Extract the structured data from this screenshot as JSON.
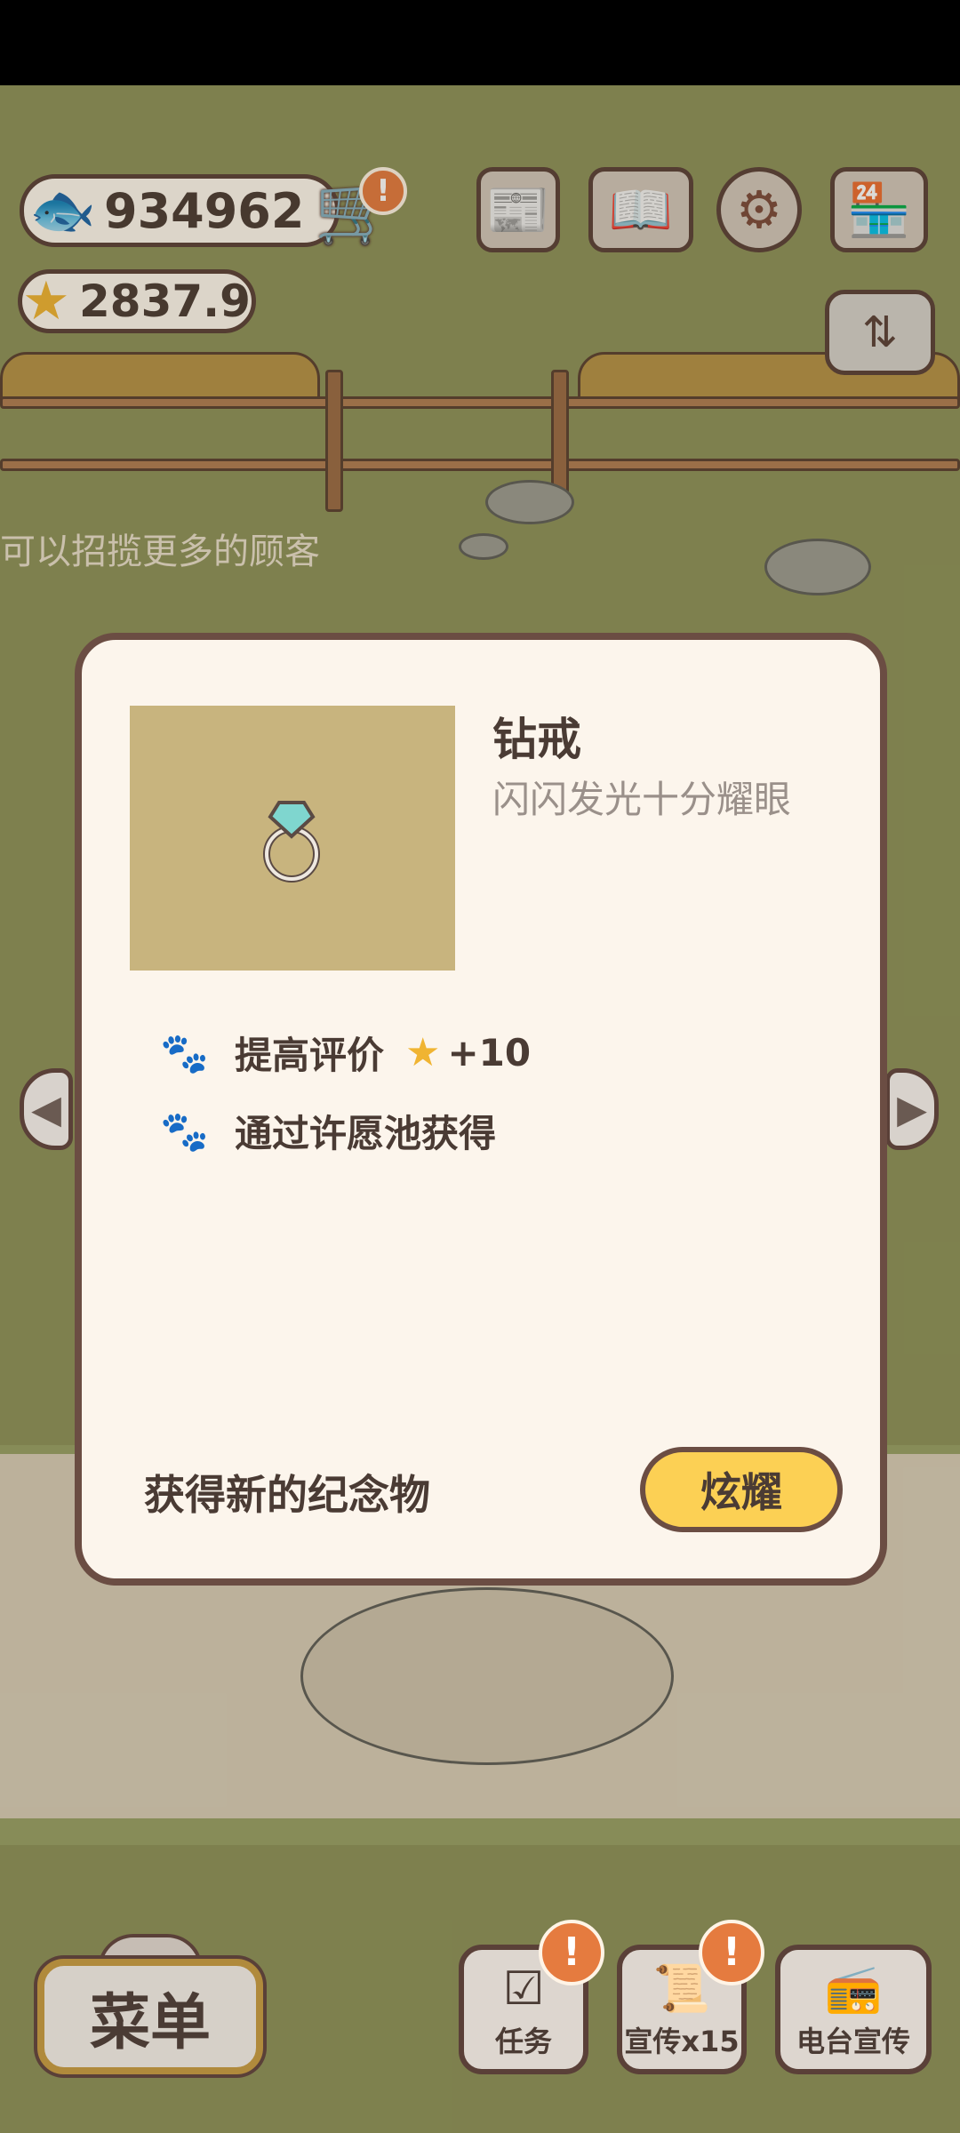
{
  "hud": {
    "fish_count": "934962",
    "star_rating": "2837.9",
    "alert_mark": "!"
  },
  "icons": {
    "fish": "fish-icon",
    "star": "star-icon",
    "cart": "cart-icon",
    "newspaper": "newspaper-icon",
    "book": "book-icon",
    "gear": "gear-icon",
    "shop": "shop-icon",
    "layout": "layout-toggle-icon",
    "paw": "paw-icon",
    "ring": "diamond-ring-icon"
  },
  "background": {
    "hint_text": "可以招揽更多的顾客"
  },
  "modal": {
    "item_name": "钻戒",
    "item_description": "闪闪发光十分耀眼",
    "effect_label": "提高评价",
    "effect_value": "+10",
    "source_text": "通过许愿池获得",
    "footer_text": "获得新的纪念物",
    "show_button": "炫耀"
  },
  "bottom_bar": {
    "menu_label": "菜单",
    "tasks_label": "任务",
    "promo_label": "宣传x15",
    "radio_label": "电台宣传"
  },
  "colors": {
    "grass": "#8d9259",
    "modal_bg": "#fcf5ec",
    "accent_button": "#fcd054",
    "alert": "#e57b3f",
    "border": "#6b4d43"
  }
}
